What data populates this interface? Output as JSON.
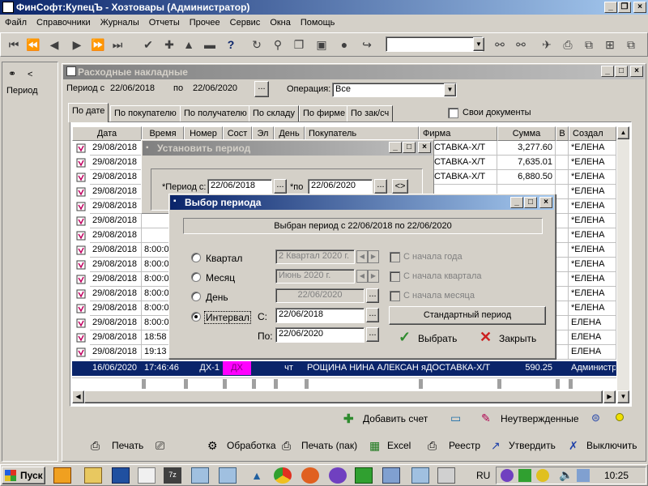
{
  "app": {
    "title": "ФинСофт:КупецЪ - Хозтовары  (Администратор)",
    "menu": [
      "Файл",
      "Справочники",
      "Журналы",
      "Отчеты",
      "Прочее",
      "Сервис",
      "Окна",
      "Помощь"
    ]
  },
  "left_panel": {
    "label": "Период",
    "arrow": "<"
  },
  "doc_window": {
    "title": "Расходные накладные",
    "period_from_label": "Период с",
    "period_from": "22/06/2018",
    "period_to_label": "по",
    "period_to": "22/06/2020",
    "ellipsis": "...",
    "operation_label": "Операция:",
    "operation_value": "Все",
    "own_docs_label": "Свои документы",
    "tabs": [
      "По дате",
      "По покупателю",
      "По получателю",
      "По складу",
      "По фирме",
      "По зак/сч"
    ],
    "columns": [
      "Дата",
      "Время",
      "Номер",
      "Сост",
      "Эл",
      "День",
      "Покупатель",
      "Фирма",
      "Сумма",
      "В",
      "Создал"
    ],
    "rows": [
      {
        "date": "29/08/2018",
        "time": "",
        "firm": "ДОСТАВКА-Х/Т",
        "sum": "3,277.60",
        "creator": "*ЕЛЕНА"
      },
      {
        "date": "29/08/2018",
        "time": "",
        "firm": "ДОСТАВКА-Х/Т",
        "sum": "7,635.01",
        "creator": "*ЕЛЕНА"
      },
      {
        "date": "29/08/2018",
        "time": "",
        "firm": "ДОСТАВКА-Х/Т",
        "sum": "6,880.50",
        "creator": "*ЕЛЕНА"
      },
      {
        "date": "29/08/2018",
        "time": "",
        "firm": "",
        "sum": "",
        "creator": "*ЕЛЕНА"
      },
      {
        "date": "29/08/2018",
        "time": "",
        "firm": "",
        "sum": "",
        "creator": "*ЕЛЕНА"
      },
      {
        "date": "29/08/2018",
        "time": "",
        "firm": "",
        "sum": "",
        "creator": "*ЕЛЕНА"
      },
      {
        "date": "29/08/2018",
        "time": "",
        "firm": "",
        "sum": "",
        "creator": "*ЕЛЕНА"
      },
      {
        "date": "29/08/2018",
        "time": "8:00:0",
        "firm": "",
        "sum": "",
        "creator": "*ЕЛЕНА"
      },
      {
        "date": "29/08/2018",
        "time": "8:00:0",
        "firm": "",
        "sum": "",
        "creator": "*ЕЛЕНА"
      },
      {
        "date": "29/08/2018",
        "time": "8:00:0",
        "firm": "",
        "sum": "",
        "creator": "*ЕЛЕНА"
      },
      {
        "date": "29/08/2018",
        "time": "8:00:0",
        "firm": "",
        "sum": "",
        "creator": "*ЕЛЕНА"
      },
      {
        "date": "29/08/2018",
        "time": "8:00:0",
        "firm": "",
        "sum": "",
        "creator": "*ЕЛЕНА"
      },
      {
        "date": "29/08/2018",
        "time": "8:00:0",
        "firm": "",
        "sum": "",
        "creator": "ЕЛЕНА"
      },
      {
        "date": "29/08/2018",
        "time": "18:58",
        "firm": "",
        "sum": "",
        "creator": "ЕЛЕНА"
      },
      {
        "date": "29/08/2018",
        "time": "19:13",
        "firm": "",
        "sum": "",
        "creator": "ЕЛЕНА"
      }
    ],
    "selected_row": {
      "date": "16/06/2020",
      "time": "17:46:46",
      "number": "ДХ-1",
      "state": "ДХ",
      "day": "чт",
      "buyer": "РОЩИНА НИНА АЛЕКСАН",
      "firm": "яДОСТАВКА-Х/Т",
      "sum": "590.25",
      "creator": "Администр"
    },
    "add_invoice": "Добавить счет",
    "unconfirmed": "Неутвержденные"
  },
  "set_period_dialog": {
    "title": "Установить период",
    "from_label": "*Период с:",
    "from": "22/06/2018",
    "to_label": "*по",
    "to": "22/06/2020",
    "ellipsis": "...",
    "swap": "<>"
  },
  "choose_period_dialog": {
    "title": "Выбор периода",
    "banner": "Выбран период с 22/06/2018 по 22/06/2020",
    "quarter_label": "Квартал",
    "quarter_value": "2 Квартал 2020 г.",
    "month_label": "Месяц",
    "month_value": "Июнь 2020 г.",
    "day_label": "День",
    "day_value": "22/06/2020",
    "interval_label": "Интервал",
    "from_label": "С:",
    "from": "22/06/2018",
    "to_label": "По:",
    "to": "22/06/2020",
    "ellipsis": "...",
    "ytd_label": "С начала года",
    "qtd_label": "С начала квартала",
    "mtd_label": "С начала месяца",
    "standard_button": "Стандартный период",
    "select_button": "Выбрать",
    "close_button": "Закрыть"
  },
  "bottom_toolbar": [
    "Печать",
    "Обработка",
    "Печать (пак)",
    "Excel",
    "Реестр",
    "Утвердить",
    "Выключить"
  ],
  "taskbar": {
    "start": "Пуск",
    "lang": "RU",
    "time": "10:25"
  },
  "colors": {
    "title_active": "#0a246a",
    "title_gradient_end": "#a6caf0",
    "selection": "#0a246a",
    "state_badge": "#ff00ff",
    "face": "#d4d0c8",
    "select_check": "#2e8b2e",
    "close_x": "#cc2020"
  }
}
